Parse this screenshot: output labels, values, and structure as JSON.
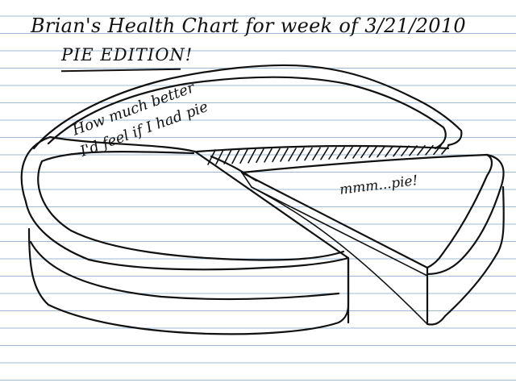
{
  "notebook": {
    "title": "Brian's Health Chart for week of 3/21/2010",
    "subtitle": "PIE EDITION!",
    "notes": {
      "missing_slice": "How much better I'd feel if I had pie",
      "slice": "mmm...pie!"
    },
    "colors": {
      "ink": "#111111",
      "paper": "#ffffff",
      "rule_line": "#9fb8d6"
    },
    "illustration": "hand-drawn-pie-with-slice"
  }
}
